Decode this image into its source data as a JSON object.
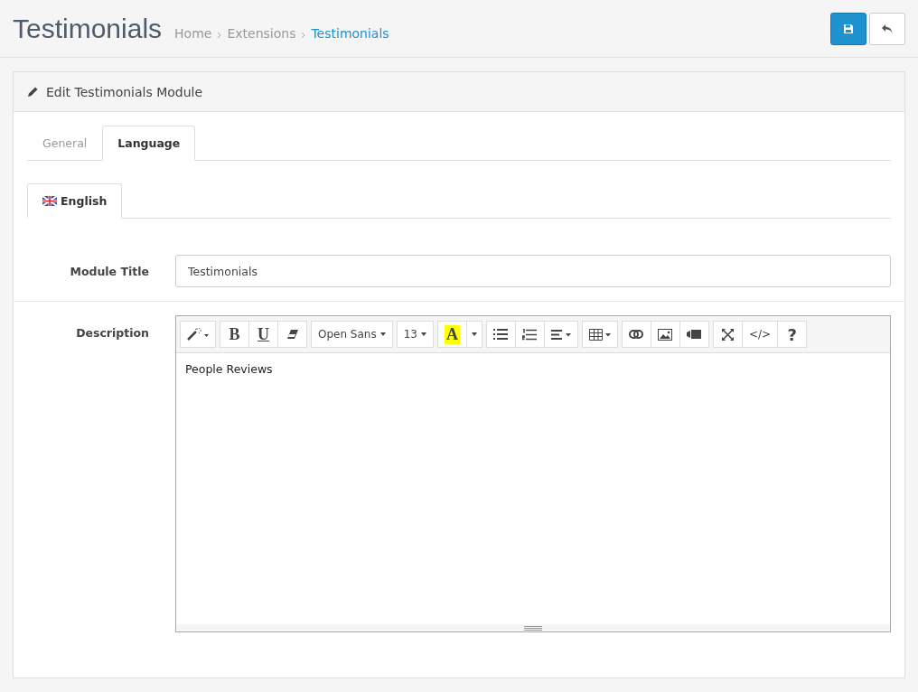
{
  "page": {
    "title": "Testimonials",
    "breadcrumb": [
      {
        "label": "Home",
        "current": false
      },
      {
        "label": "Extensions",
        "current": false
      },
      {
        "label": "Testimonials",
        "current": true
      }
    ]
  },
  "panel": {
    "title": "Edit Testimonials Module"
  },
  "tabs": [
    {
      "label": "General",
      "selected": false
    },
    {
      "label": "Language",
      "selected": true
    }
  ],
  "language_tabs": [
    {
      "label": "English",
      "selected": true
    }
  ],
  "fields": [
    {
      "label": "Module Title",
      "value": "Testimonials"
    }
  ],
  "description": {
    "label": "Description",
    "content": "People Reviews",
    "toolbar": [
      [
        {
          "kind": "magic"
        }
      ],
      [
        {
          "kind": "bold",
          "label": "B"
        },
        {
          "kind": "underline",
          "label": "U"
        },
        {
          "kind": "eraser"
        }
      ],
      [
        {
          "kind": "font",
          "label": "Open Sans"
        }
      ],
      [
        {
          "kind": "size",
          "label": "13"
        }
      ],
      [
        {
          "kind": "color",
          "label": "A"
        },
        {
          "kind": "color-caret"
        }
      ],
      [
        {
          "kind": "ul"
        },
        {
          "kind": "ol"
        },
        {
          "kind": "align"
        }
      ],
      [
        {
          "kind": "table"
        }
      ],
      [
        {
          "kind": "link"
        },
        {
          "kind": "image"
        },
        {
          "kind": "video"
        }
      ],
      [
        {
          "kind": "fullscreen"
        },
        {
          "kind": "code",
          "label": "</>"
        },
        {
          "kind": "help",
          "label": "?"
        }
      ]
    ]
  }
}
